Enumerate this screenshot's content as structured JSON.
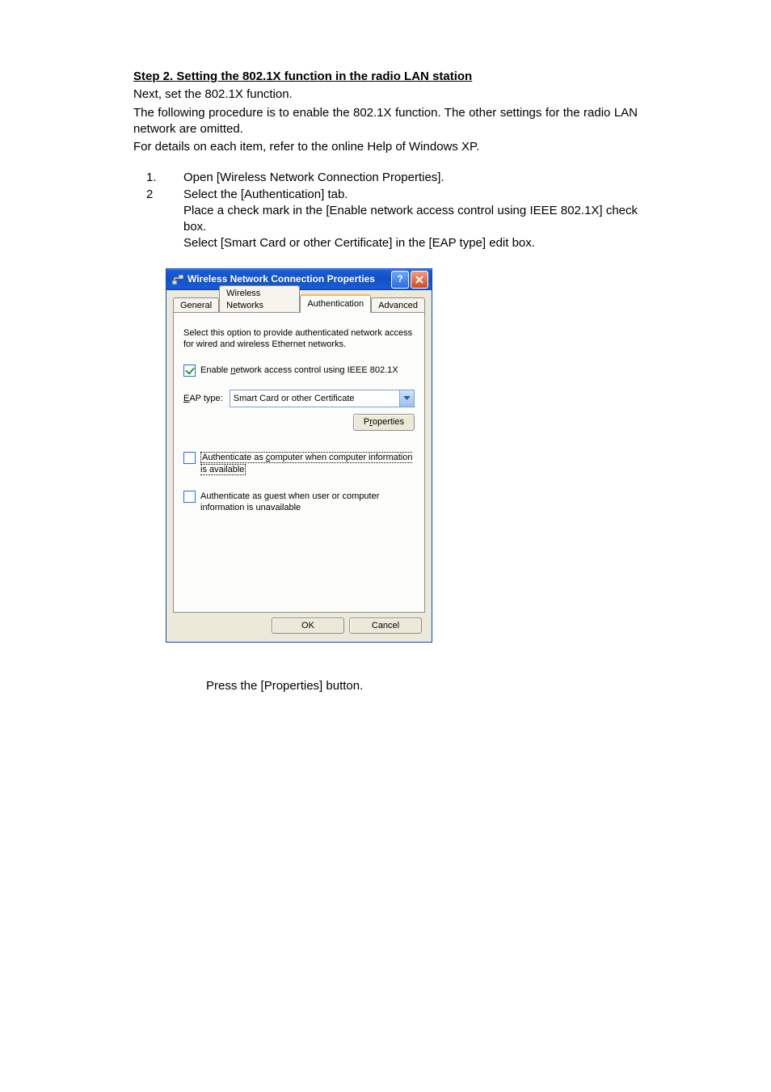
{
  "doc": {
    "step_heading": "Step 2.   Setting the 802.1X function in the radio LAN station",
    "p1": "Next, set the 802.1X function.",
    "p2": "The following procedure is to enable the 802.1X function.  The other settings for the radio LAN network are omitted.",
    "p3": "For details on each item, refer to the online Help of Windows XP.",
    "steps": [
      {
        "num": "1.",
        "text": "Open [Wireless Network Connection Properties]."
      },
      {
        "num": "2",
        "text": "Select the [Authentication] tab."
      }
    ],
    "sub1": "Place a check mark in the [Enable network access control using IEEE 802.1X] check box.",
    "sub2": "Select [Smart Card or other Certificate] in the [EAP type] edit box.",
    "after": "Press the [Properties] button."
  },
  "dialog": {
    "title": "Wireless Network Connection Properties",
    "tabs": {
      "general": "General",
      "wireless": "Wireless Networks",
      "auth": "Authentication",
      "advanced": "Advanced"
    },
    "desc": "Select this option to provide authenticated network access for wired and wireless Ethernet networks.",
    "enable_label_pre": "Enable ",
    "enable_label_ul": "n",
    "enable_label_post": "etwork access control using IEEE 802.1X",
    "eap_label_ul": "E",
    "eap_label_post": "AP type:",
    "eap_value": "Smart Card or other Certificate",
    "properties_pre": "P",
    "properties_ul": "r",
    "properties_post": "operties",
    "chk_comp_pre": "Authenticate as ",
    "chk_comp_ul": "c",
    "chk_comp_post": "omputer when computer information is available",
    "chk_guest_pre": "Authenticate as ",
    "chk_guest_ul": "g",
    "chk_guest_post": "uest when user or computer information is unavailable",
    "ok": "OK",
    "cancel": "Cancel"
  }
}
